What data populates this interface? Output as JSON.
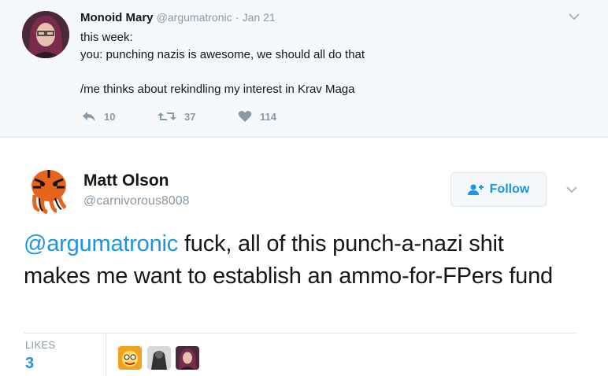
{
  "parent_tweet": {
    "author_name": "Monoid Mary",
    "handle": "@argumatronic",
    "separator": "·",
    "date": "Jan 21",
    "text": "this week:\nyou: punching nazis is awesome, we should all do that\n\n/me thinks about rekindling my interest in Krav Maga",
    "replies": "10",
    "retweets": "37",
    "likes": "114"
  },
  "main_tweet": {
    "author_name": "Matt Olson",
    "handle": "@carnivorous8008",
    "follow_label": "Follow",
    "mention": "@argumatronic",
    "text": " fuck, all of this punch-a-nazi shit makes me want to establish an ammo-for-FPers fund",
    "likes_label": "LIKES",
    "likes_count": "3"
  },
  "colors": {
    "accent": "#1b95e0",
    "muted": "#8899a6",
    "parent_bg": "#f5f8fa"
  },
  "icons": [
    "reply-icon",
    "retweet-icon",
    "heart-icon",
    "chevron-down-icon",
    "follow-person-icon"
  ]
}
